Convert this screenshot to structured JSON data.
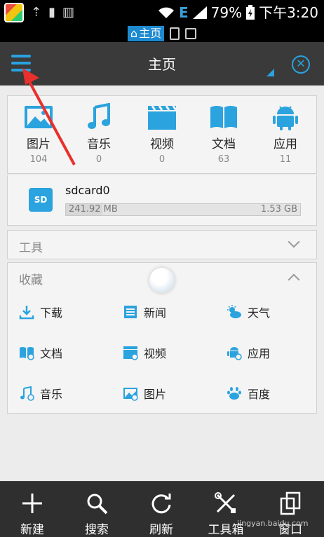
{
  "status_bar": {
    "network": "E",
    "battery": "79%",
    "time": "下午3:20"
  },
  "window_tabs": {
    "active_label": "主页"
  },
  "header": {
    "title": "主页"
  },
  "categories": [
    {
      "label": "图片",
      "count": "104",
      "icon": "image-icon"
    },
    {
      "label": "音乐",
      "count": "0",
      "icon": "music-icon"
    },
    {
      "label": "视频",
      "count": "0",
      "icon": "video-icon"
    },
    {
      "label": "文档",
      "count": "63",
      "icon": "book-icon"
    },
    {
      "label": "应用",
      "count": "11",
      "icon": "android-icon"
    }
  ],
  "storage": {
    "icon_text": "SD",
    "name": "sdcard0",
    "used": "241.92 MB",
    "total": "1.53 GB",
    "used_fraction": 0.155
  },
  "tools_section": {
    "title": "工具"
  },
  "favorites_section": {
    "title": "收藏",
    "items": [
      {
        "label": "下载",
        "icon": "download-icon"
      },
      {
        "label": "新闻",
        "icon": "news-icon"
      },
      {
        "label": "天气",
        "icon": "weather-icon"
      },
      {
        "label": "文档",
        "icon": "book-icon"
      },
      {
        "label": "视频",
        "icon": "video-icon"
      },
      {
        "label": "应用",
        "icon": "android-icon"
      },
      {
        "label": "音乐",
        "icon": "music-icon"
      },
      {
        "label": "图片",
        "icon": "image-icon"
      },
      {
        "label": "百度",
        "icon": "baidu-icon"
      }
    ]
  },
  "toolbar": {
    "new_label": "新建",
    "search_label": "搜索",
    "refresh_label": "刷新",
    "tools_label": "工具箱",
    "windows_label": "窗口"
  },
  "watermark": "jingyan.baidu.com",
  "colors": {
    "accent": "#29a3e0",
    "header_bg": "#3a3a3a",
    "content_bg": "#ececec",
    "annotation_arrow": "#e8302c"
  }
}
